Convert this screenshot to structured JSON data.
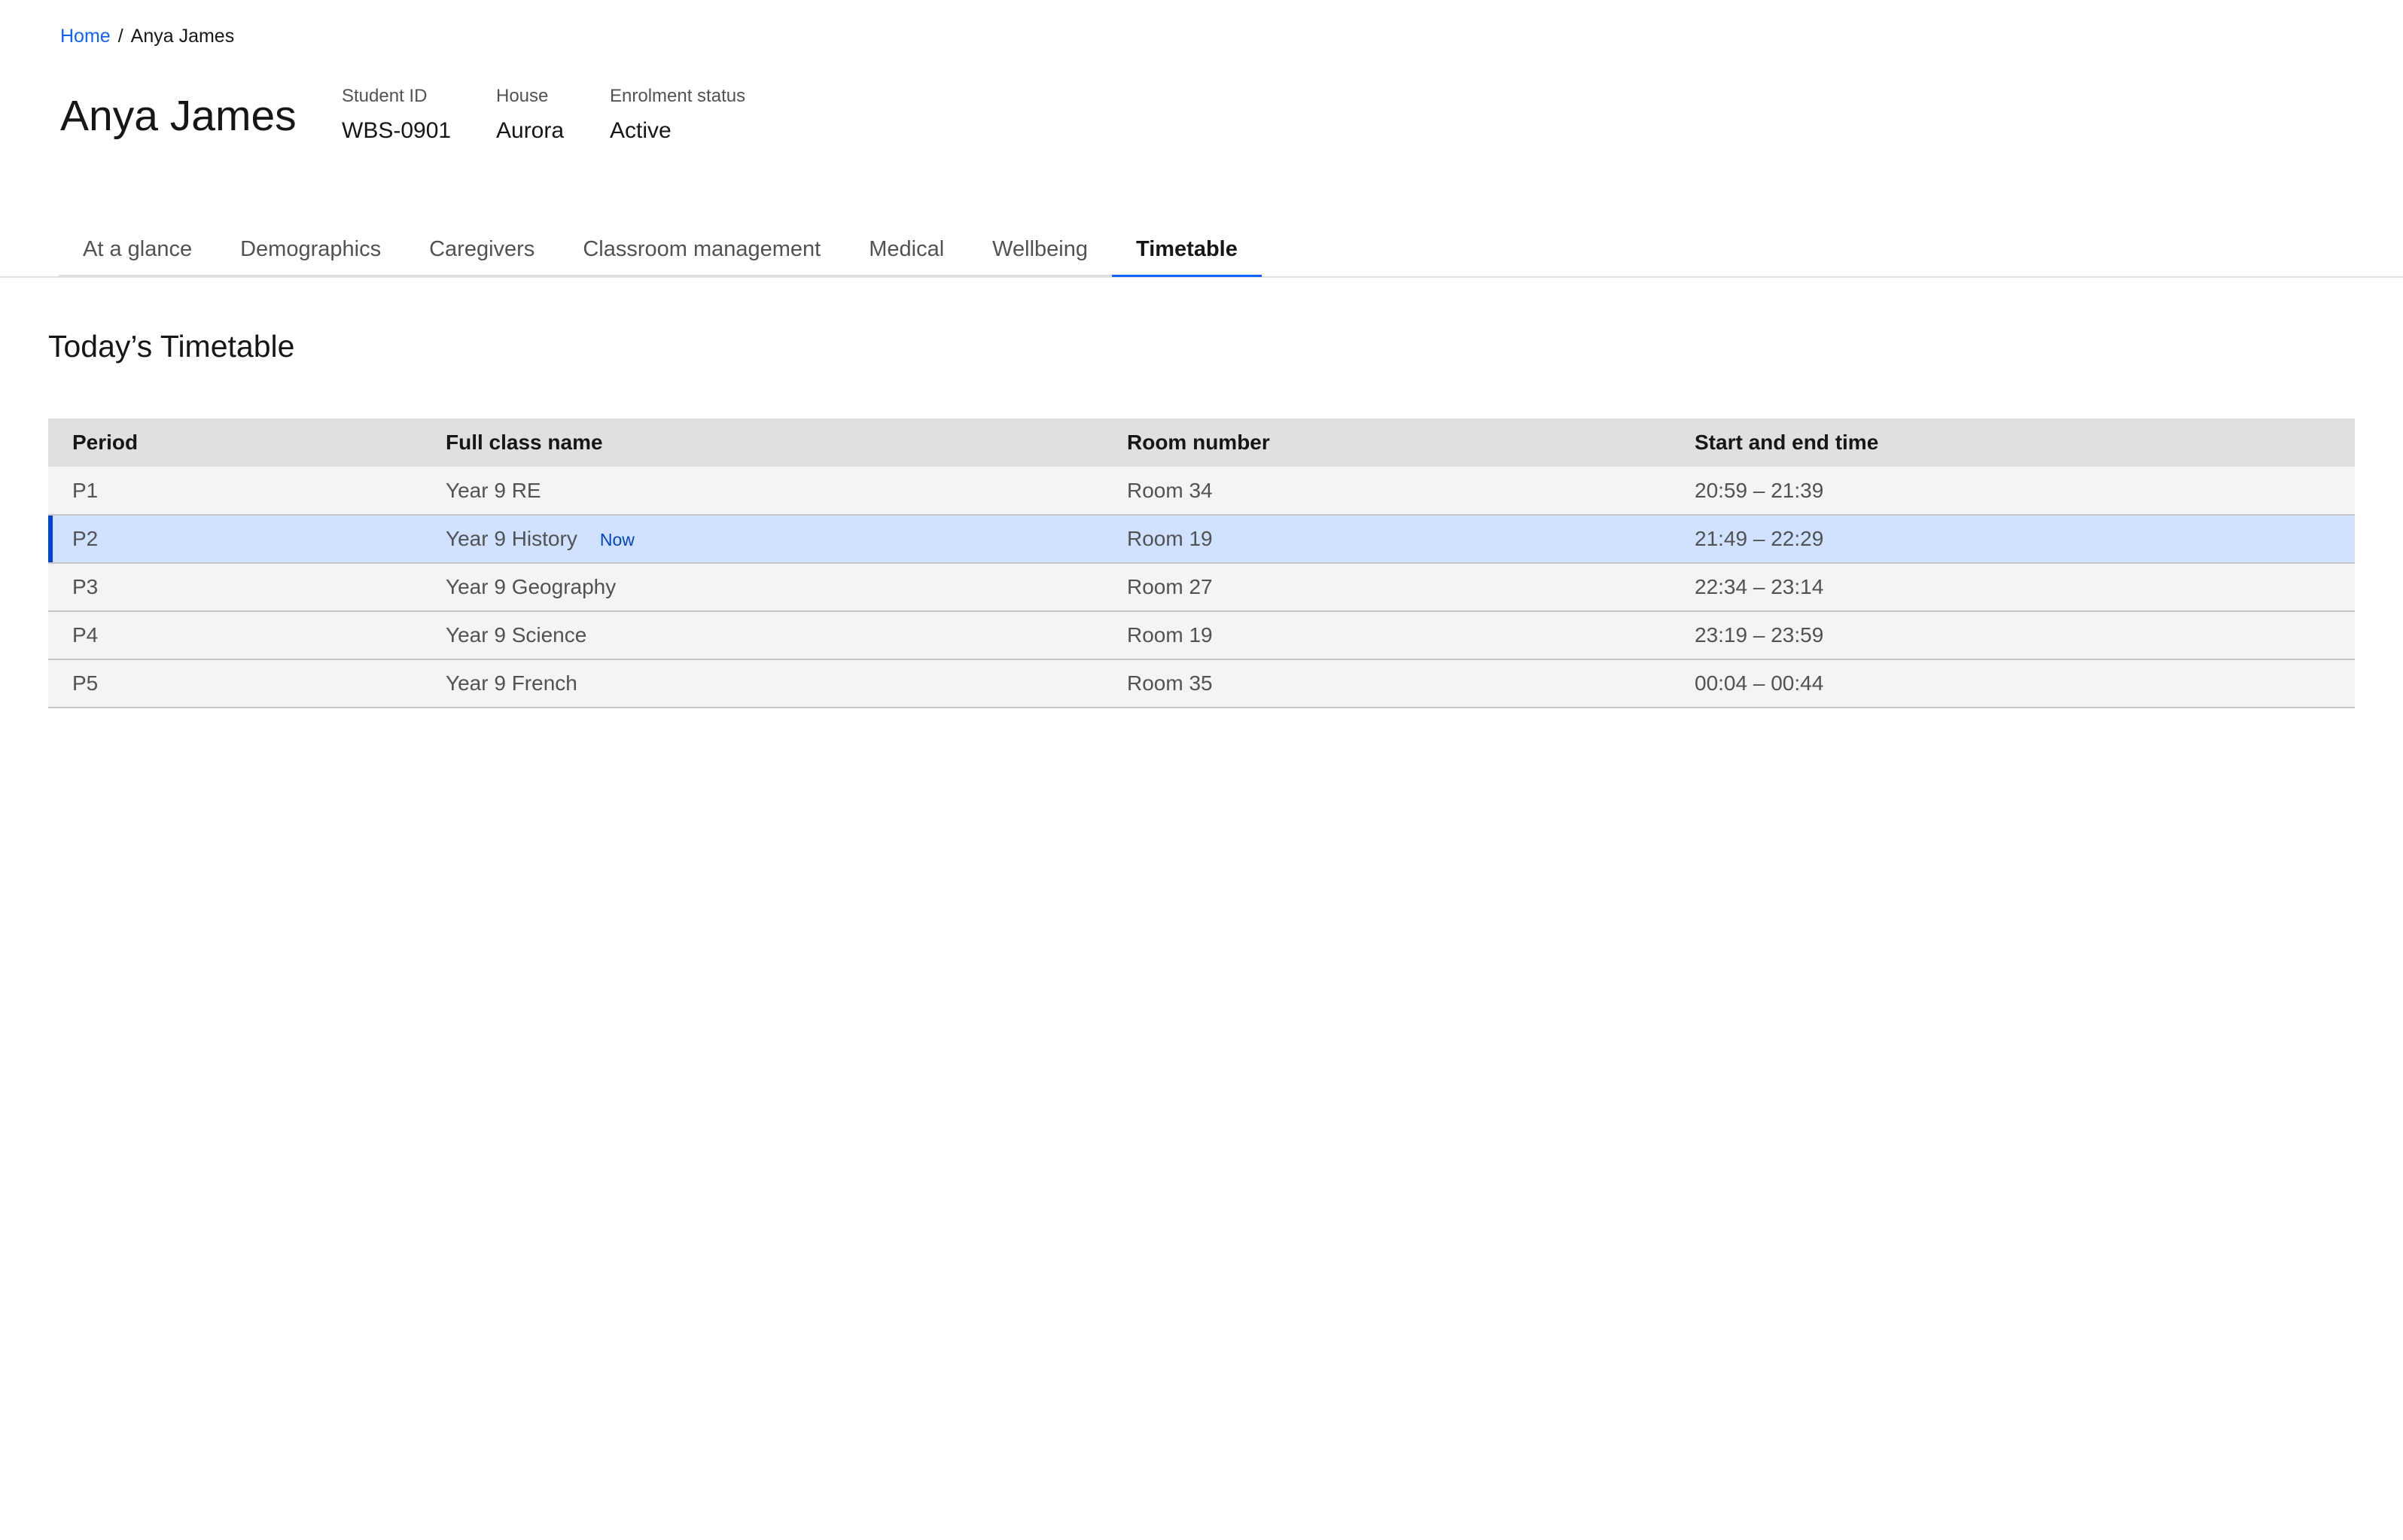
{
  "breadcrumb": {
    "home": "Home",
    "separator": "/",
    "current": "Anya James"
  },
  "student": {
    "name": "Anya James",
    "fields": [
      {
        "label": "Student ID",
        "value": "WBS-0901"
      },
      {
        "label": "House",
        "value": "Aurora"
      },
      {
        "label": "Enrolment status",
        "value": "Active"
      }
    ]
  },
  "tabs": [
    {
      "label": "At a glance",
      "selected": false
    },
    {
      "label": "Demographics",
      "selected": false
    },
    {
      "label": "Caregivers",
      "selected": false
    },
    {
      "label": "Classroom management",
      "selected": false
    },
    {
      "label": "Medical",
      "selected": false
    },
    {
      "label": "Wellbeing",
      "selected": false
    },
    {
      "label": "Timetable",
      "selected": true
    }
  ],
  "section": {
    "title": "Today’s Timetable"
  },
  "table": {
    "headers": [
      "Period",
      "Full class name",
      "Room number",
      "Start and end time"
    ],
    "rows": [
      {
        "period": "P1",
        "class": "Year 9 RE",
        "room": "Room 34",
        "time": "20:59 – 21:39",
        "now": false
      },
      {
        "period": "P2",
        "class": "Year 9 History",
        "room": "Room 19",
        "time": "21:49 – 22:29",
        "now": true,
        "now_label": "Now"
      },
      {
        "period": "P3",
        "class": "Year 9 Geography",
        "room": "Room 27",
        "time": "22:34 – 23:14",
        "now": false
      },
      {
        "period": "P4",
        "class": "Year 9 Science",
        "room": "Room 19",
        "time": "23:19 – 23:59",
        "now": false
      },
      {
        "period": "P5",
        "class": "Year 9 French",
        "room": "Room 35",
        "time": "00:04 – 00:44",
        "now": false
      }
    ]
  },
  "colors": {
    "accent": "#0f62fe",
    "current_row_bg": "#d0e2ff",
    "current_row_marker": "#0043ce",
    "header_bg": "#e0e0e0",
    "row_bg": "#f4f4f4"
  }
}
